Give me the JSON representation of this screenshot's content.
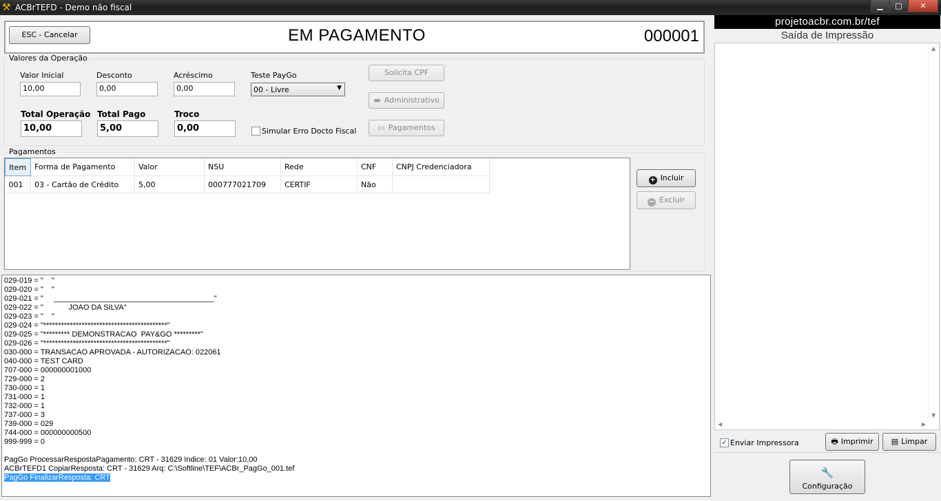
{
  "window": {
    "title": "ACBrTEFD - Demo não fiscal",
    "minimize_icon": "minimize-icon",
    "maximize_icon": "maximize-icon",
    "close_icon": "close-icon"
  },
  "header": {
    "cancel_button": "ESC - Cancelar",
    "title": "EM PAGAMENTO",
    "number": "000001"
  },
  "operation": {
    "legend": "Valores da Operação",
    "valor_inicial_label": "Valor Inicial",
    "valor_inicial": "10,00",
    "desconto_label": "Desconto",
    "desconto": "0,00",
    "acrescimo_label": "Acréscimo",
    "acrescimo": "0,00",
    "teste_paygo_label": "Teste PayGo",
    "teste_paygo_value": "00 - Livre",
    "total_operacao_label": "Total Operação",
    "total_operacao": "10,00",
    "total_pago_label": "Total Pago",
    "total_pago": "5,00",
    "troco_label": "Troco",
    "troco": "0,00",
    "simular_erro_label": "Simular Erro Docto Fiscal",
    "simular_erro_checked": false,
    "solicita_cpf_button": "Solicita CPF",
    "administrativo_button": "Administrativo",
    "pagamentos_button": "Pagamentos"
  },
  "payments": {
    "legend": "Pagamentos",
    "columns": [
      "Item",
      "Forma de Pagamento",
      "Valor",
      "NSU",
      "Rede",
      "CNF",
      "CNPJ Credenciadora"
    ],
    "rows": [
      [
        "001",
        "03 - Cartão de Crédito",
        "5,00",
        "000777021709",
        "CERTIF",
        "Não",
        ""
      ]
    ],
    "incluir_button": "Incluir",
    "excluir_button": "Excluir"
  },
  "log": {
    "lines": [
      "029-019 = \"    \"",
      "029-020 = \"    \"",
      "029-021 = \"     ______________________________________\"",
      "029-022 = \"            JOAO DA SILVA\"",
      "029-023 = \"    \"",
      "029-024 = \"******************************************\"",
      "029-025 = \"********* DEMONSTRACAO  PAY&GO *********\"",
      "029-026 = \"******************************************\"",
      "030-000 = TRANSACAO APROVADA - AUTORIZACAO: 022061",
      "040-000 = TEST CARD",
      "707-000 = 000000001000",
      "729-000 = 2",
      "730-000 = 1",
      "731-000 = 1",
      "732-000 = 1",
      "737-000 = 3",
      "739-000 = 029",
      "744-000 = 000000000500",
      "999-999 = 0",
      "",
      "PagGo ProcessarRespostaPagamento: CRT - 31629 Indice: 01 Valor:10,00",
      "ACBrTEFD1 CopiarResposta: CRT - 31629 Arq: C:\\Softline\\TEF\\ACBr_PagGo_001.tef"
    ],
    "selected_line": "PagGo FinalizarResposta: CRT"
  },
  "print_panel": {
    "url": "projetoacbr.com.br/tef",
    "title": "Saída de Impressão",
    "enviar_impressora_label": "Enviar Impressora",
    "enviar_impressora_checked": true,
    "imprimir_button": "Imprimir",
    "limpar_button": "Limpar",
    "configuracao_button": "Configuração"
  }
}
